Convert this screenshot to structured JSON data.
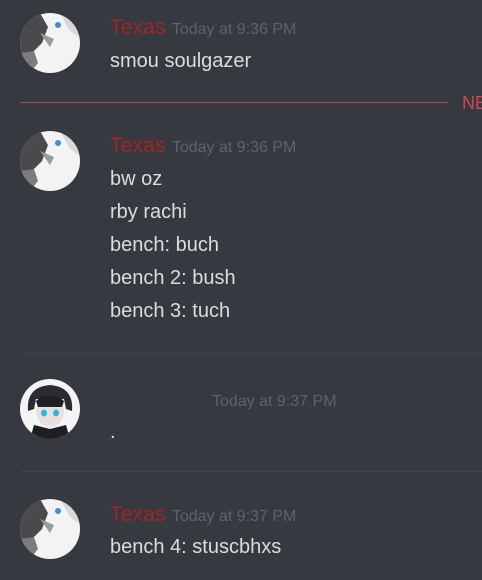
{
  "colors": {
    "background": "#36393f",
    "username": "#a32424",
    "timestamp": "#5f6268",
    "message_text": "#dcddde",
    "new_divider": "#d04656",
    "separator": "#40444b"
  },
  "new_messages_divider": {
    "label": "NE"
  },
  "messages": [
    {
      "avatar_icon": "wolf-avatar-icon",
      "username": "Texas",
      "timestamp": "Today at 9:36 PM",
      "lines": [
        "smou soulgazer"
      ]
    },
    {
      "avatar_icon": "wolf-avatar-icon",
      "username": "Texas",
      "timestamp": "Today at 9:36 PM",
      "lines": [
        "bw oz",
        "rby rachi",
        "bench: buch",
        "bench 2: bush",
        "bench 3: tuch"
      ]
    },
    {
      "avatar_icon": "anime-character-avatar-icon",
      "username": "",
      "timestamp": "Today at 9:37 PM",
      "lines": [
        "."
      ]
    },
    {
      "avatar_icon": "wolf-avatar-icon",
      "username": "Texas",
      "timestamp": "Today at 9:37 PM",
      "lines": [
        "bench 4: stuscbhxs"
      ]
    }
  ]
}
